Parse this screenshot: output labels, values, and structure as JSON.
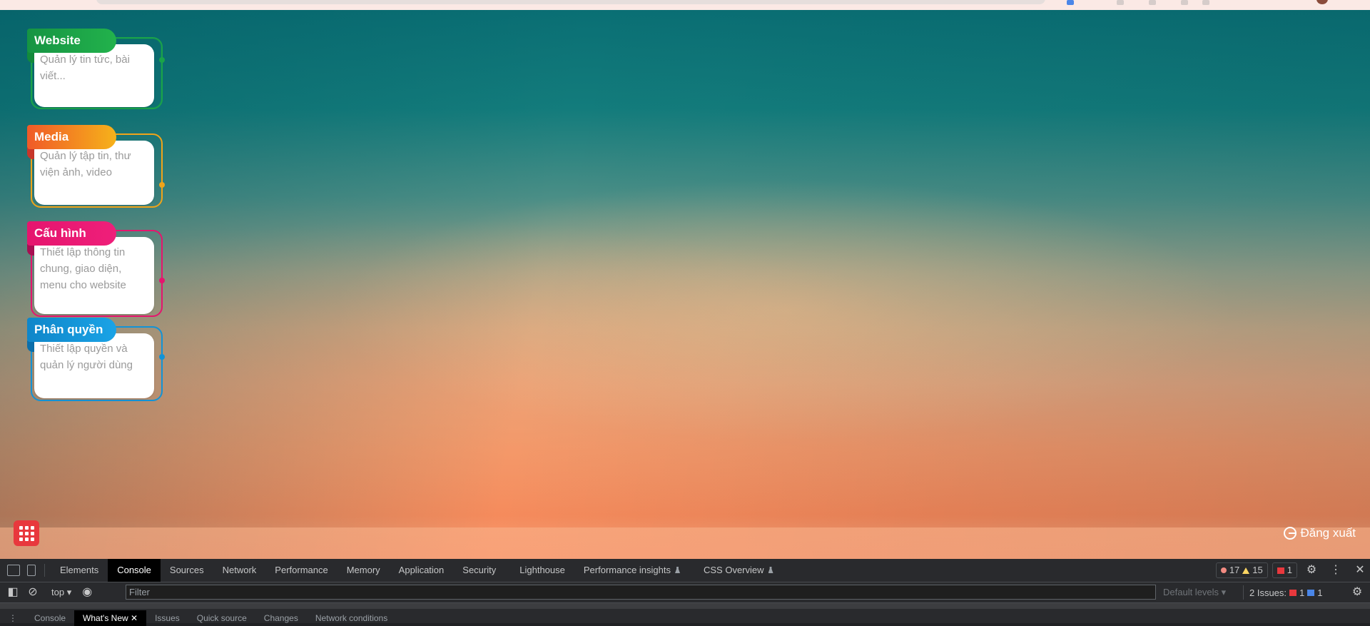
{
  "cards": [
    {
      "title": "Website",
      "desc": "Quản lý tin tức, bài viết...",
      "color": "#1aa34a",
      "tab_to": "#22b24c"
    },
    {
      "title": "Media",
      "desc": "Quản lý tập tin, thư viện ảnh, video",
      "color": "#f0a419",
      "tab_from": "#f05a28",
      "tab_to": "#f6b21a"
    },
    {
      "title": "Cấu hình",
      "desc": "Thiết lập thông tin chung, giao diện, menu cho website",
      "color": "#e5156e"
    },
    {
      "title": "Phân quyền",
      "desc": "Thiết lập quyền và quản lý người dùng",
      "color": "#1293d6"
    }
  ],
  "launcher": {
    "icon": "grid-icon"
  },
  "logout": {
    "label": "Đăng xuất",
    "icon": "logout-icon"
  },
  "devtools": {
    "tabs": [
      "Elements",
      "Console",
      "Sources",
      "Network",
      "Performance",
      "Memory",
      "Application",
      "Security",
      "Lighthouse",
      "Performance insights",
      "CSS Overview"
    ],
    "active_tab": "Console",
    "errors": "17",
    "warnings": "15",
    "issues_badge": "1",
    "context": "top",
    "filter_placeholder": "Filter",
    "levels": "Default levels",
    "issues_label": "2 Issues:",
    "issues_red": "1",
    "issues_blue": "1",
    "drawer_tabs": [
      "Console",
      "What's New",
      "Issues",
      "Quick source",
      "Changes",
      "Network conditions"
    ],
    "drawer_active": "What's New"
  }
}
